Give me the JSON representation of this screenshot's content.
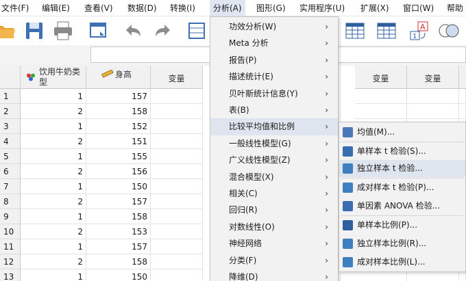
{
  "menubar": [
    "文件(F)",
    "编辑(E)",
    "查看(V)",
    "数据(D)",
    "转换(I)",
    "分析(A)",
    "图形(G)",
    "实用程序(U)",
    "扩展(X)",
    "窗口(W)",
    "帮助"
  ],
  "toolbar": {
    "icons": [
      "open-folder-icon",
      "save-icon",
      "print-icon",
      "dialog-recall-icon",
      "undo-icon",
      "redo-icon",
      "goto-case-icon",
      "table-grid-icon",
      "value-labels-icon",
      "use-sets-icon"
    ]
  },
  "grid": {
    "columns": [
      {
        "label": "饮用牛奶类型",
        "icon": "nominal-variable-icon"
      },
      {
        "label": "身高",
        "icon": "scale-variable-icon"
      },
      {
        "label": "变量"
      },
      {
        "label": "变量"
      },
      {
        "label": "变量"
      }
    ],
    "rows": [
      {
        "n": "1",
        "milk": "1",
        "height": "157"
      },
      {
        "n": "2",
        "milk": "2",
        "height": "158"
      },
      {
        "n": "3",
        "milk": "1",
        "height": "152"
      },
      {
        "n": "4",
        "milk": "2",
        "height": "151"
      },
      {
        "n": "5",
        "milk": "1",
        "height": "155"
      },
      {
        "n": "6",
        "milk": "2",
        "height": "156"
      },
      {
        "n": "7",
        "milk": "1",
        "height": "150"
      },
      {
        "n": "8",
        "milk": "2",
        "height": "157"
      },
      {
        "n": "9",
        "milk": "1",
        "height": "158"
      },
      {
        "n": "10",
        "milk": "2",
        "height": "153"
      },
      {
        "n": "11",
        "milk": "1",
        "height": "157"
      },
      {
        "n": "12",
        "milk": "2",
        "height": "158"
      },
      {
        "n": "13",
        "milk": "1",
        "height": "150"
      }
    ]
  },
  "analyze_menu": {
    "items": [
      {
        "label": "功效分析(W)",
        "submenu": true
      },
      {
        "label": "Meta 分析",
        "submenu": true
      },
      {
        "label": "报告(P)",
        "submenu": true
      },
      {
        "label": "描述统计(E)",
        "submenu": true
      },
      {
        "label": "贝叶斯统计信息(Y)",
        "submenu": true
      },
      {
        "label": "表(B)",
        "submenu": true
      },
      {
        "label": "比较平均值和比例",
        "submenu": true,
        "selected": true
      },
      {
        "label": "一般线性模型(G)",
        "submenu": true
      },
      {
        "label": "广义线性模型(Z)",
        "submenu": true
      },
      {
        "label": "混合模型(X)",
        "submenu": true
      },
      {
        "label": "相关(C)",
        "submenu": true
      },
      {
        "label": "回归(R)",
        "submenu": true
      },
      {
        "label": "对数线性(O)",
        "submenu": true
      },
      {
        "label": "神经网络",
        "submenu": true
      },
      {
        "label": "分类(F)",
        "submenu": true
      },
      {
        "label": "降维(D)",
        "submenu": true
      }
    ]
  },
  "compare_submenu": {
    "items": [
      {
        "label": "均值(M)...",
        "icon": "means-icon",
        "color": "#4a78b8"
      },
      {
        "label": "单样本 t 检验(S)...",
        "icon": "one-sample-t-icon",
        "color": "#3a6cb0"
      },
      {
        "label": "独立样本 t 检验...",
        "icon": "independent-t-icon",
        "color": "#3f7fc0",
        "selected": true
      },
      {
        "label": "成对样本 t 检验(P)...",
        "icon": "paired-t-icon",
        "color": "#3f7fc0"
      },
      {
        "label": "单因素 ANOVA 检验...",
        "icon": "one-way-anova-icon",
        "color": "#3a6cb0"
      },
      {
        "label": "单样本比例(P)...",
        "icon": "one-sample-proportion-icon",
        "color": "#2f5f9f"
      },
      {
        "label": "独立样本比例(R)...",
        "icon": "independent-proportion-icon",
        "color": "#3f7fc0"
      },
      {
        "label": "成对样本比例(L)...",
        "icon": "paired-proportion-icon",
        "color": "#3f7fc0"
      }
    ]
  },
  "colors": {
    "menu_highlight": "#dfe6f1",
    "icon_blue": "#3f7fc0"
  }
}
